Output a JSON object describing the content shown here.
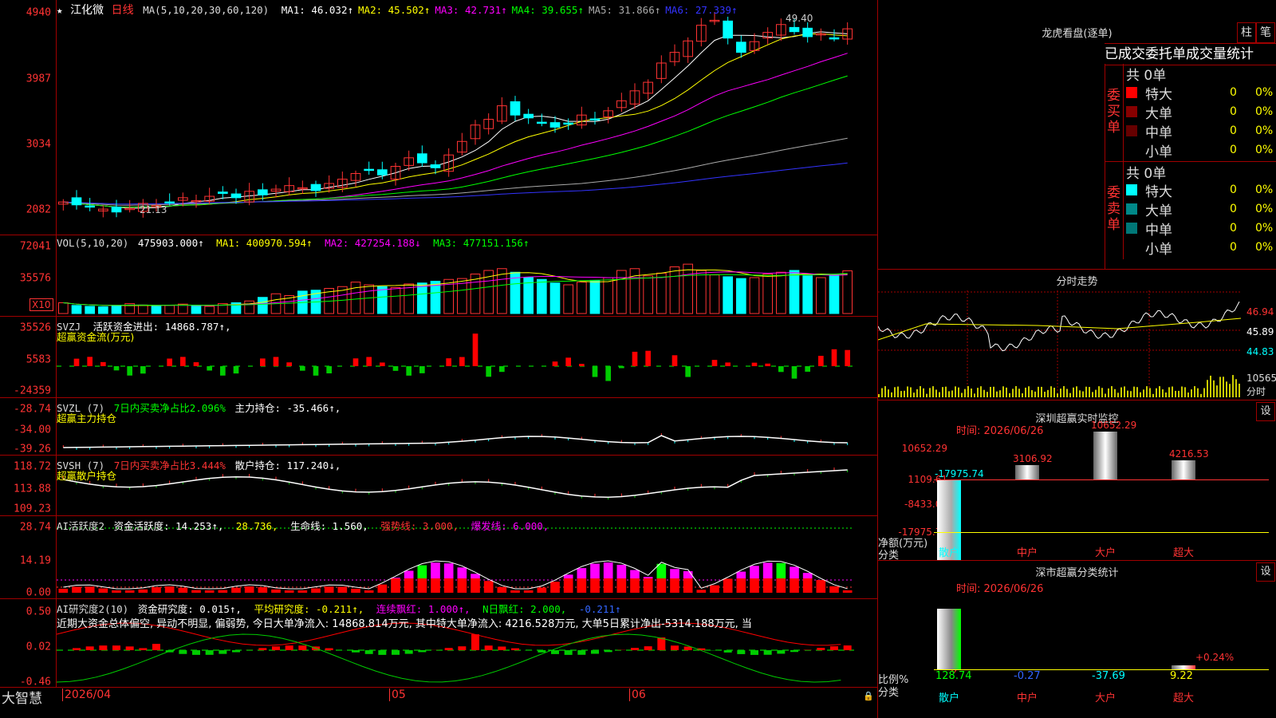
{
  "stock": {
    "name": "江化微",
    "period": "日线",
    "ma_label": "MA(5,10,20,30,60,120)",
    "ma": [
      {
        "label": "MA1:",
        "value": "46.032↑",
        "color": "#ffffff"
      },
      {
        "label": "MA2:",
        "value": "45.502↑",
        "color": "#ffff00"
      },
      {
        "label": "MA3:",
        "value": "42.731↑",
        "color": "#ff00ff"
      },
      {
        "label": "MA4:",
        "value": "39.655↑",
        "color": "#00ff00"
      },
      {
        "label": "MA5:",
        "value": "31.866↑",
        "color": "#aaaaaa"
      },
      {
        "label": "MA6:",
        "value": "27.339↑",
        "color": "#3333ff"
      }
    ],
    "price_axis": [
      "4940",
      "3987",
      "3034",
      "2082"
    ],
    "high_label": "49.40",
    "low_label": "21.13",
    "star": "★"
  },
  "vol": {
    "label": "VOL(5,10,20)",
    "value": "475903.000↑",
    "ma1": "MA1: 400970.594↑",
    "ma2": "MA2: 427254.188↓",
    "ma3": "MA3: 477151.156↑",
    "axis": [
      "72041",
      "35576"
    ],
    "unit": "X10"
  },
  "svzj": {
    "label": "SVZJ",
    "desc": "活跃资金进出: 14868.787↑,",
    "sub": "超赢资金流(万元)",
    "axis": [
      "35526",
      "5583",
      "-24359"
    ]
  },
  "svzl": {
    "label": "SVZL (7)",
    "pct": "7日内买卖净占比2.096%",
    "main": "主力持仓: -35.466↑,",
    "sub": "超赢主力持仓",
    "axis": [
      "-28.74",
      "-34.00",
      "-39.26"
    ]
  },
  "svsh": {
    "label": "SVSH (7)",
    "pct": "7日内买卖净占比3.444%",
    "retail": "散户持仓: 117.240↓,",
    "sub": "超赢散户持仓",
    "axis": [
      "118.72",
      "113.88",
      "109.23"
    ]
  },
  "ai1": {
    "label": "AI活跃度2",
    "a": "资金活跃度: 14.253↑,",
    "b": "28.736,",
    "c": "生命线: 1.560,",
    "d": "强势线: 3.000,",
    "e": "爆发线: 6.000,",
    "axis": [
      "28.74",
      "14.19",
      "0.00"
    ]
  },
  "ai2": {
    "label": "AI研究度2(10)",
    "a": "资金研究度: 0.015↑,",
    "b": "平均研究度: -0.211↑,",
    "c": "连续飘红: 1.000↑,",
    "d": "N日飘红: 2.000,",
    "e": "-0.211↑",
    "text": "近期大资金总体偏空, 异动不明显, 偏弱势, 今日大单净流入: 14868.814万元, 其中特大单净流入: 4216.528万元, 大单5日累计净出-5314.188万元, 当",
    "axis": [
      "0.50",
      "0.02",
      "-0.46"
    ]
  },
  "footer": {
    "brand": "大智慧",
    "dates": [
      "2026/04",
      "05",
      "06"
    ]
  },
  "longhu": {
    "title": "龙虎看盘(逐单)",
    "btn1": "柱",
    "btn2": "笔",
    "tabs": "已成交委托单成交量统计",
    "buy_side": "委买单",
    "sell_side": "委卖单",
    "buy_total": "共 0单",
    "sell_total": "共 0单",
    "buy_rows": [
      {
        "label": "特大",
        "count": "0",
        "pct": "0%",
        "color": "#ff0000"
      },
      {
        "label": "大单",
        "count": "0",
        "pct": "0%",
        "color": "#880000"
      },
      {
        "label": "中单",
        "count": "0",
        "pct": "0%",
        "color": "#660000"
      },
      {
        "label": "小单",
        "count": "0",
        "pct": "0%",
        "color": "#000000"
      }
    ],
    "sell_rows": [
      {
        "label": "特大",
        "count": "0",
        "pct": "0%",
        "color": "#00ffff"
      },
      {
        "label": "大单",
        "count": "0",
        "pct": "0%",
        "color": "#008888"
      },
      {
        "label": "中单",
        "count": "0",
        "pct": "0%",
        "color": "#007777"
      },
      {
        "label": "小单",
        "count": "0",
        "pct": "0%",
        "color": "#000000"
      }
    ]
  },
  "intraday": {
    "title": "分时走势",
    "price_labels": [
      "46.94",
      "45.89",
      "44.83"
    ],
    "vol_labels": [
      "10565",
      "分时"
    ]
  },
  "sz_monitor": {
    "title": "深圳超赢实时监控",
    "btn": "设",
    "time": "时间: 2026/06/26",
    "axis": [
      "10652.29",
      "1109.61",
      "-8433.06",
      "-17975.74"
    ],
    "ylabel": "净额(万元)",
    "xlabel": "分类",
    "bars": [
      {
        "cat": "散户",
        "value": "-17975.74"
      },
      {
        "cat": "中户",
        "value": "3106.92"
      },
      {
        "cat": "大户",
        "value": "10652.29"
      },
      {
        "cat": "超大",
        "value": "4216.53"
      }
    ]
  },
  "sz_class": {
    "title": "深市超赢分类统计",
    "btn": "设",
    "time": "时间: 2026/06/26",
    "axis": [
      "75",
      "50",
      "25",
      "0"
    ],
    "ylabel": "比例%",
    "xlabel": "分类",
    "annotation": "+0.24%",
    "bars": [
      {
        "cat": "散户",
        "value": "128.74"
      },
      {
        "cat": "中户",
        "value": "-0.27"
      },
      {
        "cat": "大户",
        "value": "-37.69"
      },
      {
        "cat": "超大",
        "value": "9.22"
      }
    ]
  },
  "chart_data": [
    {
      "type": "candlestick",
      "title": "江化微 日线",
      "ylim": [
        20.0,
        50.0
      ],
      "note": "price values read from chart (approx)",
      "close": [
        23.0,
        22.6,
        22.3,
        22.0,
        21.6,
        22.1,
        22.8,
        22.5,
        23.0,
        23.6,
        23.2,
        23.8,
        24.2,
        23.6,
        24.5,
        24.0,
        24.8,
        25.3,
        25.0,
        24.6,
        25.6,
        26.2,
        27.0,
        27.5,
        26.8,
        28.0,
        29.2,
        28.5,
        27.8,
        29.6,
        31.5,
        33.8,
        34.6,
        36.5,
        35.2,
        34.8,
        34.1,
        33.5,
        34.0,
        35.2,
        34.6,
        35.8,
        37.2,
        38.6,
        39.8,
        42.5,
        44.0,
        45.6,
        47.8,
        48.5,
        46.0,
        44.0,
        45.5,
        46.8,
        47.9,
        46.9,
        46.2,
        46.6,
        46.0,
        47.3
      ],
      "colors": {
        "up": "#ff3333",
        "down": "#00ffff"
      }
    },
    {
      "type": "bar",
      "title": "VOL(5,10,20)",
      "ylim": [
        0,
        80000
      ],
      "values": [
        12000,
        9000,
        8000,
        7500,
        9000,
        11000,
        9500,
        8000,
        9000,
        10500,
        9000,
        8000,
        11000,
        12000,
        14000,
        18000,
        22000,
        20000,
        25000,
        26000,
        28000,
        30000,
        35000,
        32000,
        30000,
        29000,
        33000,
        34000,
        36000,
        38000,
        39000,
        44000,
        48000,
        50000,
        46000,
        40000,
        38000,
        34000,
        32000,
        35000,
        37000,
        40000,
        48000,
        50000,
        42000,
        45000,
        52000,
        55000,
        48000,
        43000,
        41000,
        39000,
        40000,
        44000,
        46000,
        48000,
        42000,
        40000,
        43000,
        47590
      ]
    }
  ]
}
